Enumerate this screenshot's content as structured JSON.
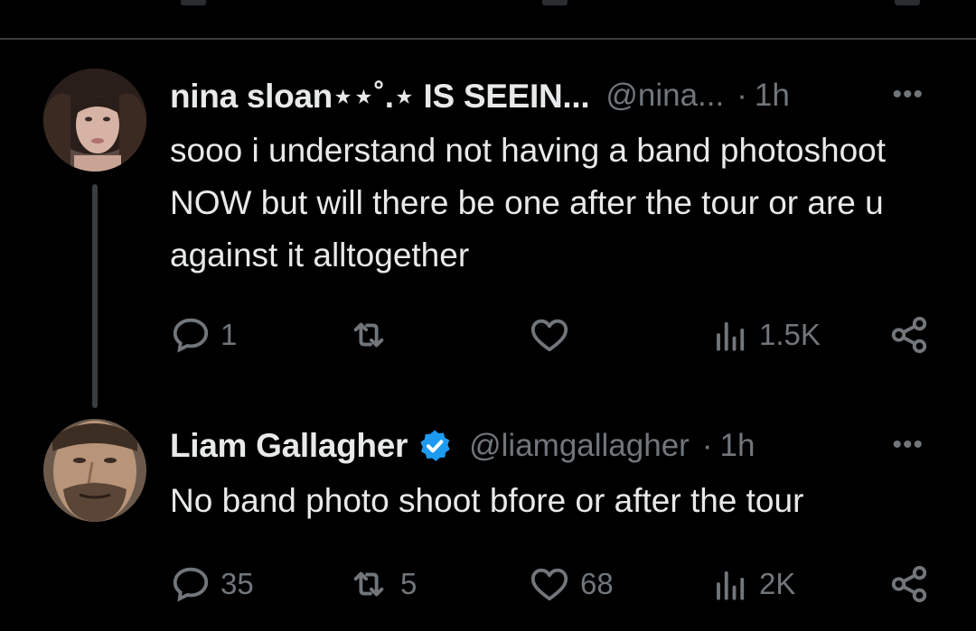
{
  "tweets": [
    {
      "display_name": "nina sloan⋆⋆˚.⋆ IS SEEIN...",
      "handle": "@nina...",
      "separator": "·",
      "time": "1h",
      "more": "•••",
      "text": "sooo i understand not having a band photoshoot NOW but will there be one after the tour or are u against it alltogether",
      "actions": {
        "replies": "1",
        "reposts": "",
        "likes": "",
        "views": "1.5K"
      },
      "verified": false
    },
    {
      "display_name": "Liam Gallagher",
      "handle": "@liamgallagher",
      "separator": "·",
      "time": "1h",
      "more": "•••",
      "text": "No band photo shoot bfore or after the tour",
      "actions": {
        "replies": "35",
        "reposts": "5",
        "likes": "68",
        "views": "2K"
      },
      "verified": true
    }
  ],
  "colors": {
    "background": "#000000",
    "text": "#e7e9ea",
    "muted": "#71767b",
    "verified": "#1d9bf0"
  },
  "icons": [
    "reply-icon",
    "repost-icon",
    "like-icon",
    "views-icon",
    "share-icon",
    "verified-badge-icon",
    "more-icon"
  ]
}
